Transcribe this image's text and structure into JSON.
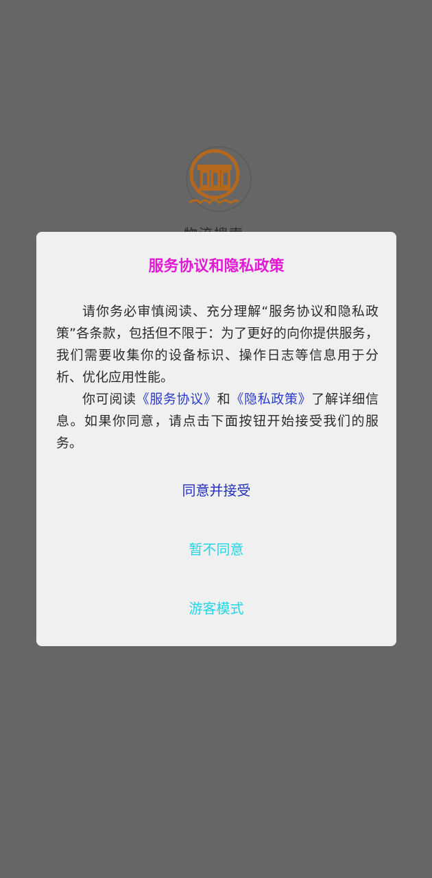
{
  "colors": {
    "backdrop": "#666666",
    "dialog_bg": "#f0f0f0",
    "title": "#e21ad6",
    "link": "#2c3cc8",
    "primary_button": "#2230c0",
    "secondary_button": "#22d6e6",
    "logo": "#b4681e"
  },
  "background": {
    "logo_icon": "app-logo-icon",
    "app_name": "物流搜索"
  },
  "dialog": {
    "title": "服务协议和隐私政策",
    "paragraph1": "请你务必审慎阅读、充分理解“服务协议和隐私政策”各条款，包括但不限于：为了更好的向你提供服务，我们需要收集你的设备标识、操作日志等信息用于分析、优化应用性能。",
    "paragraph2_prefix": "你可阅读",
    "service_agreement_link": "《服务协议》",
    "paragraph2_and": "和",
    "privacy_policy_link": "《隐私政策》",
    "paragraph2_suffix": "了解详细信息。如果你同意，请点击下面按钮开始接受我们的服务。",
    "agree_button": "同意并接受",
    "decline_button": "暂不同意",
    "guest_button": "游客模式"
  }
}
